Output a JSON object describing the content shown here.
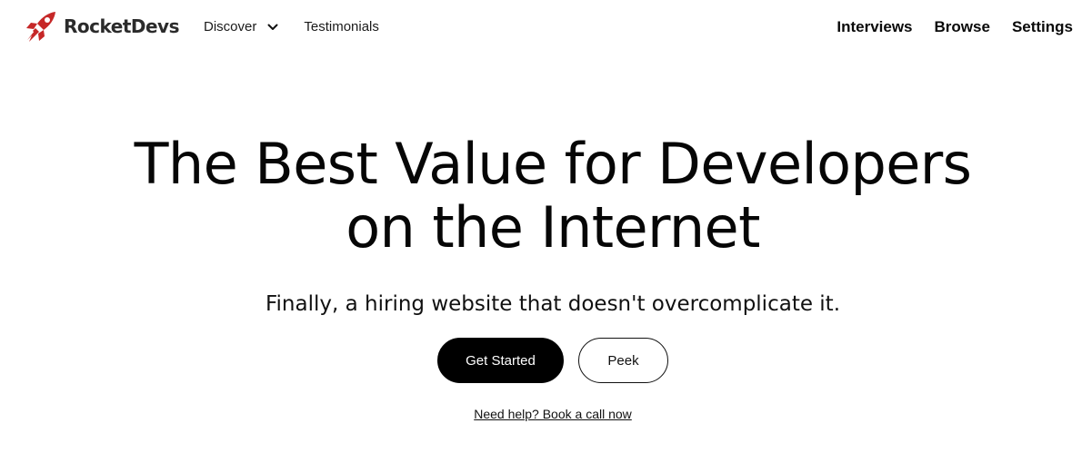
{
  "brand": {
    "name": "RocketDevs",
    "accent_color": "#c62828",
    "logo_icon": "rocket-icon"
  },
  "nav": {
    "left": [
      {
        "label": "Discover",
        "icon": "chevron-down-icon"
      },
      {
        "label": "Testimonials"
      }
    ],
    "right": [
      {
        "label": "Interviews"
      },
      {
        "label": "Browse"
      },
      {
        "label": "Settings"
      }
    ]
  },
  "hero": {
    "title_line1": "The Best Value for Developers",
    "title_line2": "on the Internet",
    "subtitle": "Finally, a hiring website that doesn't overcomplicate it.",
    "primary_button": "Get Started",
    "secondary_button": "Peek",
    "help_link": "Need help? Book a call now"
  }
}
